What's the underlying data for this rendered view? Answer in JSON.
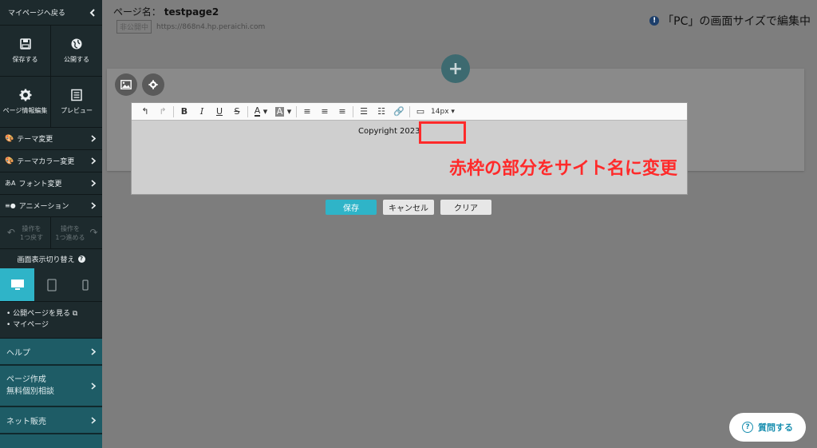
{
  "sidebar": {
    "back_label": "マイページへ戻る",
    "tiles": [
      {
        "icon": "save-icon",
        "label": "保存する"
      },
      {
        "icon": "globe-icon",
        "label": "公開する"
      },
      {
        "icon": "gear-icon",
        "label": "ページ情報編集"
      },
      {
        "icon": "preview-icon",
        "label": "プレビュー"
      }
    ],
    "menu": [
      {
        "icon": "palette-icon",
        "label": "テーマ変更"
      },
      {
        "icon": "color-palette-icon",
        "label": "テーマカラー変更"
      },
      {
        "icon": "font-icon",
        "label": "フォント変更"
      },
      {
        "icon": "animation-icon",
        "label": "アニメーション"
      }
    ],
    "undo": {
      "line1": "操作を",
      "line2": "1つ戻す"
    },
    "redo": {
      "line1": "操作を",
      "line2": "1つ進める"
    },
    "display_switch_label": "画面表示切り替え",
    "links": [
      "公開ページを見る",
      "マイページ"
    ],
    "help_label": "ヘルプ",
    "consult": {
      "line1": "ページ作成",
      "line2": "無料個別相談"
    },
    "net_sales_label": "ネット販売"
  },
  "header": {
    "page_name_label": "ページ名：",
    "page_name": "testpage2",
    "status_badge": "非公開中",
    "url": "https://868n4.hp.peraichi.com",
    "pc_note": "「PC」の画面サイズで編集中"
  },
  "editor": {
    "font_size": "14px",
    "text": "Copyright 2023",
    "annotation": "赤枠の部分をサイト名に変更"
  },
  "actions": {
    "save": "保存",
    "cancel": "キャンセル",
    "clear": "クリア"
  },
  "ask_button": "質問する",
  "colors": {
    "accent": "#2fb4c8",
    "annotation_red": "#ff2a2a",
    "sidebar_bg": "#1d2a2d"
  }
}
